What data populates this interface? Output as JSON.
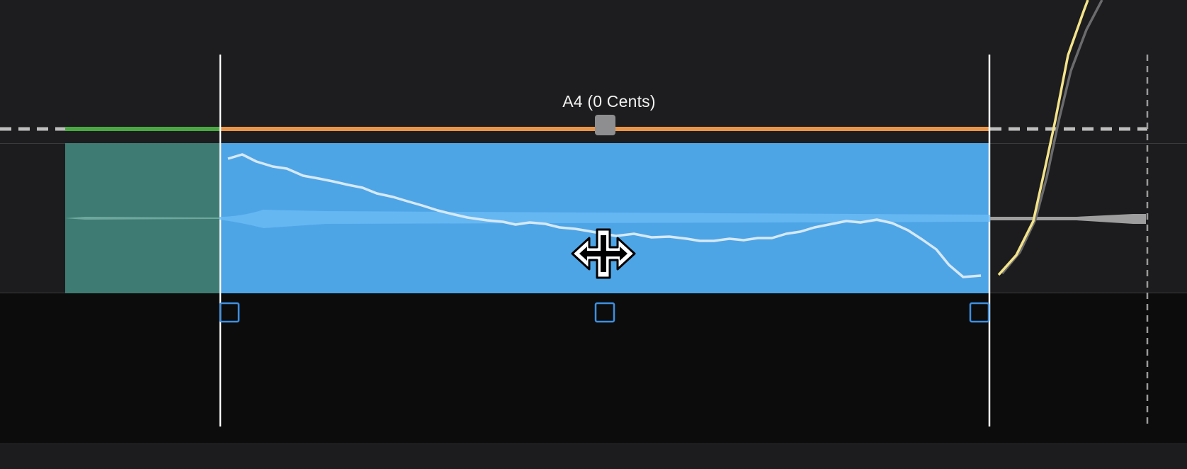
{
  "pitch_label": "A4 (0 Cents)",
  "colors": {
    "background": "#1c1c1e",
    "lower_area": "#0c0c0d",
    "selected_note": "#4ea5e6",
    "previous_note": "#3e7b72",
    "previous_note_pitch_line": "#4aa843",
    "selected_note_pitch_line": "#e8954a",
    "reference_pitch_dashed": "#bdbdbd",
    "pitch_curve": "#cfe4f5",
    "next_note_curve": "#f3e38a",
    "handle_outline": "#3f8fe0"
  },
  "icons": {
    "cursor": "move-cursor-icon",
    "left_handle": "square-handle-icon",
    "center_handle": "square-handle-icon",
    "right_handle": "square-handle-icon",
    "pitch_knob": "pitch-drag-handle-icon"
  }
}
